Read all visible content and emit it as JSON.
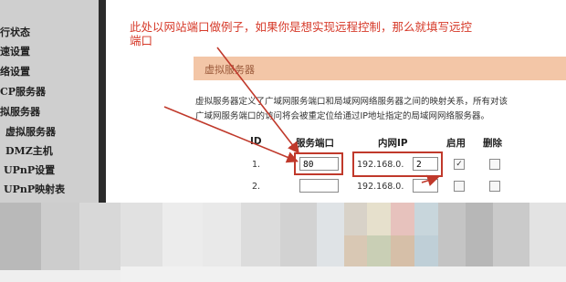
{
  "sidebar": {
    "items": [
      {
        "label": "行状态"
      },
      {
        "label": "速设置"
      },
      {
        "label": "络设置"
      },
      {
        "label": "CP服务器"
      },
      {
        "label": "拟服务器"
      },
      {
        "label": "虚拟服务器"
      },
      {
        "label": "DMZ主机"
      },
      {
        "label": "UPnP设置"
      },
      {
        "label": "UPnP映射表"
      }
    ]
  },
  "annotation": {
    "line1": "此处以网站端口做例子，如果你是想实现远程控制，那么就填写远控",
    "line2": "端口"
  },
  "panel": {
    "title": "虚拟服务器",
    "description_line1": "虚拟服务器定义了广域网服务端口和局域网网络服务器之间的映射关系，所有对该",
    "description_line2": "广域网服务端口的访问将会被重定位给通过IP地址指定的局域网网络服务器。"
  },
  "table": {
    "headers": {
      "id": "ID",
      "port": "服务端口",
      "ip": "内网IP",
      "enable": "启用",
      "delete": "删除"
    },
    "rows": [
      {
        "id": "1.",
        "port": "80",
        "ip_prefix": "192.168.0.",
        "ip_last": "2",
        "enabled": true,
        "deleted": false
      },
      {
        "id": "2.",
        "port": "",
        "ip_prefix": "192.168.0.",
        "ip_last": "",
        "enabled": false,
        "deleted": false
      }
    ]
  },
  "colors": {
    "annotation": "#d63a2a",
    "highlight_box": "#c0392b",
    "panel_header": "#f3c6a7",
    "sidebar_bg": "#cfcfcf"
  }
}
